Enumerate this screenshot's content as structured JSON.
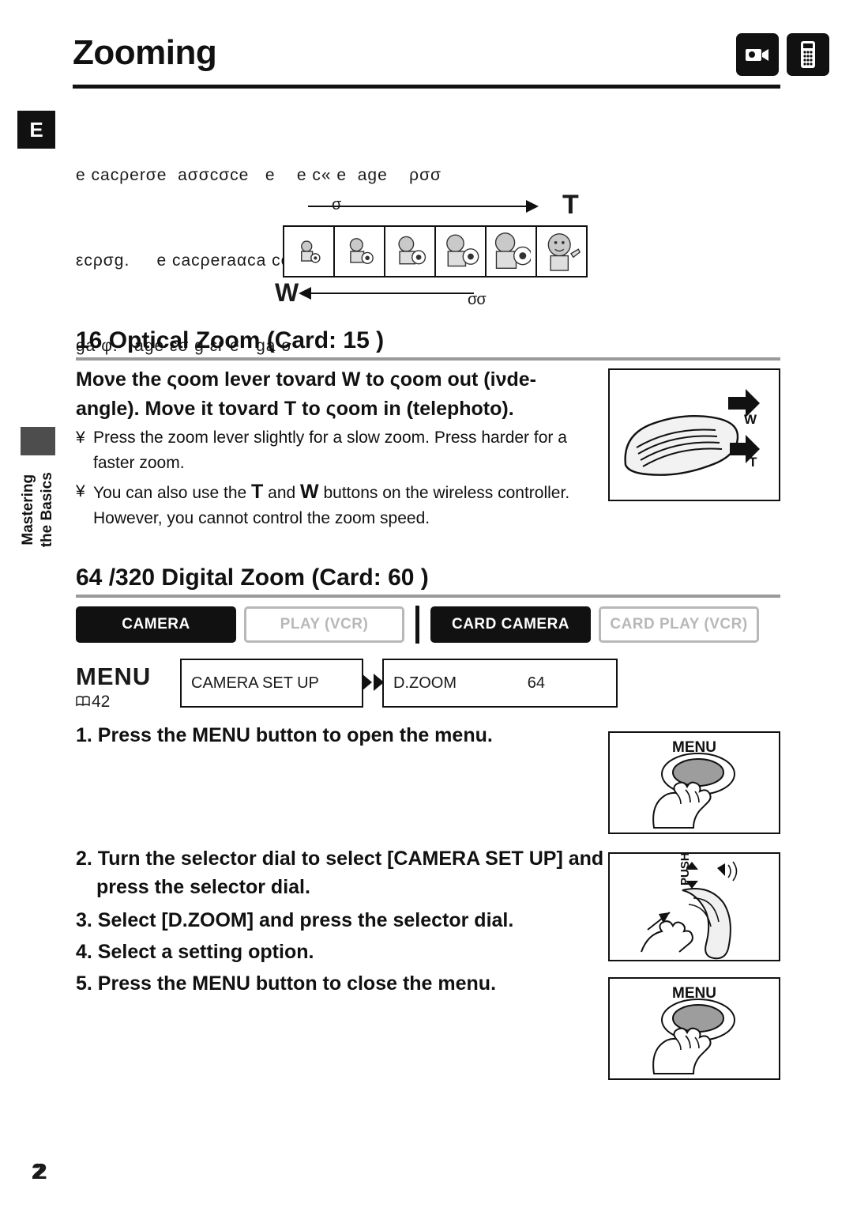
{
  "header": {
    "title": "Zooming",
    "lang_tab": "E",
    "icons": [
      "camcorder-icon",
      "remote-controller-icon"
    ]
  },
  "side": {
    "label_line1": "Mastering",
    "label_line2": "the Basics"
  },
  "intro": {
    "line1": "e cacρerσe  aσσcσce   e    e c« e  age    ρσσ",
    "line2": "εcρσg.     e cacρeraαca ce    εεε ρca ρ a",
    "line3": "ga φ.   age εσ g εr e   ga o"
  },
  "figure": {
    "label_T": "T",
    "label_W": "W",
    "label_small_left": "σ",
    "label_small_right": "σσ",
    "frames": 6
  },
  "section1": {
    "heading": "16  Optical Zoom (Card: 15  )",
    "bold1": "Moνe the ςoom leνer toνard          W to ςoom out (iνde-",
    "bold2": "angle). Moνe it toνard        T to ςoom in (telephoto).",
    "bullet1_mark": "¥",
    "bullet1": "Press the zoom lever slightly for a slow zoom. Press harder for a faster zoom.",
    "bullet2_mark": "¥",
    "bullet2_a": "You can also use the ",
    "bullet2_T": "T",
    "bullet2_b": " and ",
    "bullet2_W": "W",
    "bullet2_c": " buttons on the wireless controller. However, you cannot control the zoom speed.",
    "illustration": "zoom-lever-illustration",
    "lever_label_W": "W",
    "lever_label_T": "T"
  },
  "section2": {
    "heading": "64  /320  Digital Zoom (Card: 60  )",
    "modes": [
      {
        "label": "CAMERA",
        "active": true
      },
      {
        "label": "PLAY (VCR)",
        "active": false
      },
      {
        "label": "CARD CAMERA",
        "active": true
      },
      {
        "label": "CARD PLAY (VCR)",
        "active": false
      }
    ],
    "menu_word": "MENU",
    "menu_ref": "(    42)",
    "menu_path1": "CAMERA SET UP",
    "menu_path2_label": "D.ZOOM",
    "menu_path2_value": "64",
    "steps": [
      "1. Press the MENU button to open the menu.",
      "2. Turn the selector dial to select [CAMERA SET UP] and",
      "press the selector dial.",
      "3. Select [D.ZOOM] and press the selector dial.",
      "4. Select a setting option.",
      "5. Press the MENU button to close the menu."
    ],
    "illustrations": [
      {
        "name": "menu-button-illustration",
        "label": "MENU"
      },
      {
        "name": "selector-dial-illustration",
        "label": "PUSH"
      },
      {
        "name": "menu-button-close-illustration",
        "label": "MENU"
      }
    ]
  },
  "footer": {
    "page_number": "2"
  }
}
